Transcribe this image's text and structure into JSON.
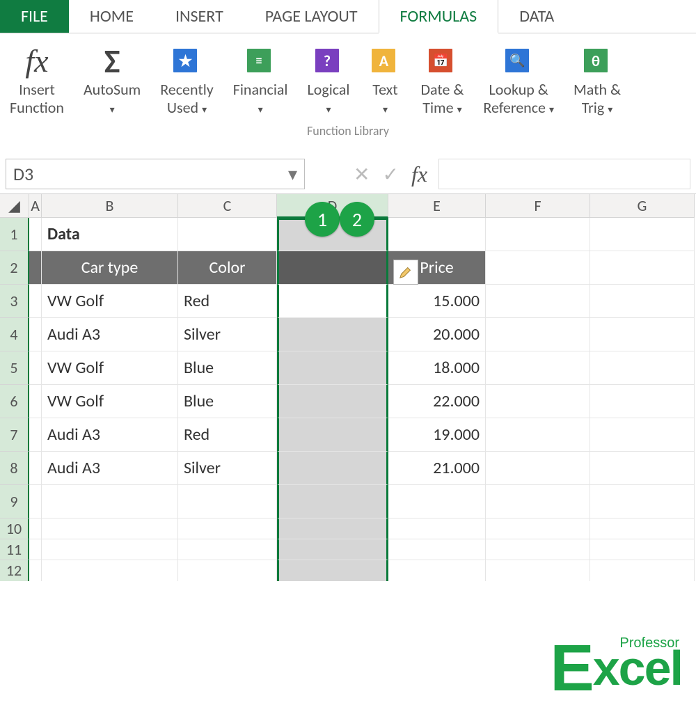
{
  "tabs": {
    "file": "FILE",
    "home": "HOME",
    "insert": "INSERT",
    "pagelayout": "PAGE LAYOUT",
    "formulas": "FORMULAS",
    "data": "DATA"
  },
  "ribbon": {
    "insert_function": "Insert\nFunction",
    "autosum": "AutoSum",
    "recently_used": "Recently\nUsed",
    "financial": "Financial",
    "logical": "Logical",
    "text": "Text",
    "datetime": "Date &\nTime",
    "lookup": "Lookup &\nReference",
    "mathtrig": "Math &\nTrig",
    "group_label": "Function Library"
  },
  "fx": {
    "namebox": "D3",
    "fx_label": "fx"
  },
  "columns": [
    "A",
    "B",
    "C",
    "D",
    "E",
    "F",
    "G"
  ],
  "rows": [
    "1",
    "2",
    "3",
    "4",
    "5",
    "6",
    "7",
    "8",
    "9",
    "10",
    "11",
    "12"
  ],
  "sheet": {
    "title": "Data",
    "headers": {
      "b": "Car type",
      "c": "Color",
      "e": "Price"
    },
    "data": [
      {
        "car": "VW Golf",
        "color": "Red",
        "price": "15.000"
      },
      {
        "car": "Audi A3",
        "color": "Silver",
        "price": "20.000"
      },
      {
        "car": "VW Golf",
        "color": "Blue",
        "price": "18.000"
      },
      {
        "car": "VW Golf",
        "color": "Blue",
        "price": "22.000"
      },
      {
        "car": "Audi A3",
        "color": "Red",
        "price": "19.000"
      },
      {
        "car": "Audi A3",
        "color": "Silver",
        "price": "21.000"
      }
    ]
  },
  "annotations": {
    "c1": "1",
    "c2": "2"
  },
  "logo": {
    "main": "xcel",
    "prefix": "E",
    "sub": "Professor"
  }
}
